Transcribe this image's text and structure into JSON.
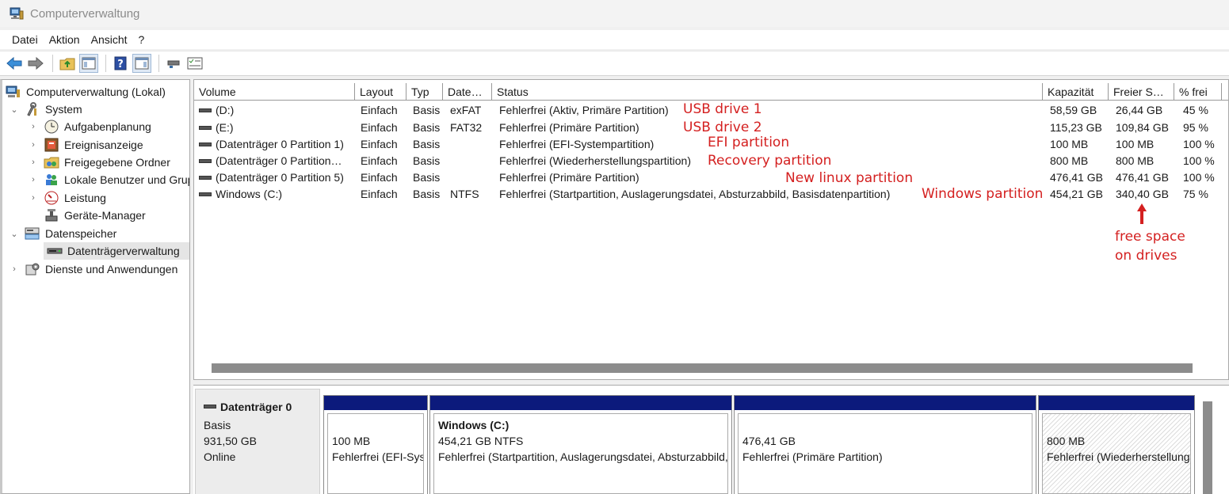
{
  "window": {
    "title": "Computerverwaltung"
  },
  "menu": [
    "Datei",
    "Aktion",
    "Ansicht",
    "?"
  ],
  "toolbar": {
    "icons": [
      "back-arrow-icon",
      "forward-arrow-icon",
      "folder-up-icon",
      "show-hide-tree-icon",
      "help-icon",
      "action-pane-icon",
      "connect-icon",
      "properties-icon"
    ]
  },
  "tree": [
    {
      "label": "Computerverwaltung (Lokal)",
      "icon": "computer-management-icon",
      "chevron": "",
      "level": 0
    },
    {
      "label": "System",
      "icon": "system-tools-icon",
      "chevron": "⌄",
      "level": 1
    },
    {
      "label": "Aufgabenplanung",
      "icon": "clock-icon",
      "chevron": "›",
      "level": 2
    },
    {
      "label": "Ereignisanzeige",
      "icon": "event-viewer-icon",
      "chevron": "›",
      "level": 2
    },
    {
      "label": "Freigegebene Ordner",
      "icon": "shared-folder-icon",
      "chevron": "›",
      "level": 2
    },
    {
      "label": "Lokale Benutzer und Gruppen",
      "icon": "users-icon",
      "chevron": "›",
      "level": 2
    },
    {
      "label": "Leistung",
      "icon": "performance-icon",
      "chevron": "›",
      "level": 2
    },
    {
      "label": "Geräte-Manager",
      "icon": "device-manager-icon",
      "chevron": "",
      "level": 2
    },
    {
      "label": "Datenspeicher",
      "icon": "storage-icon",
      "chevron": "⌄",
      "level": 1
    },
    {
      "label": "Datenträgerverwaltung",
      "icon": "disk-management-icon",
      "chevron": "",
      "level": 2,
      "selected": true
    },
    {
      "label": "Dienste und Anwendungen",
      "icon": "services-icon",
      "chevron": "›",
      "level": 1
    }
  ],
  "columns": [
    "Volume",
    "Layout",
    "Typ",
    "Date…",
    "Status",
    "Kapazität",
    "Freier S…",
    "% frei"
  ],
  "volumes": [
    {
      "volume": "(D:)",
      "layout": "Einfach",
      "typ": "Basis",
      "fs": "exFAT",
      "status": "Fehlerfrei (Aktiv, Primäre Partition)",
      "cap": "58,59 GB",
      "free": "26,44 GB",
      "pct": "45 %"
    },
    {
      "volume": "(E:)",
      "layout": "Einfach",
      "typ": "Basis",
      "fs": "FAT32",
      "status": "Fehlerfrei (Primäre Partition)",
      "cap": "115,23 GB",
      "free": "109,84 GB",
      "pct": "95 %"
    },
    {
      "volume": "(Datenträger 0 Partition 1)",
      "layout": "Einfach",
      "typ": "Basis",
      "fs": "",
      "status": "Fehlerfrei (EFI-Systempartition)",
      "cap": "100 MB",
      "free": "100 MB",
      "pct": "100 %"
    },
    {
      "volume": "(Datenträger 0 Partition…",
      "layout": "Einfach",
      "typ": "Basis",
      "fs": "",
      "status": "Fehlerfrei (Wiederherstellungspartition)",
      "cap": "800 MB",
      "free": "800 MB",
      "pct": "100 %"
    },
    {
      "volume": "(Datenträger 0 Partition 5)",
      "layout": "Einfach",
      "typ": "Basis",
      "fs": "",
      "status": "Fehlerfrei (Primäre Partition)",
      "cap": "476,41 GB",
      "free": "476,41 GB",
      "pct": "100 %"
    },
    {
      "volume": "Windows (C:)",
      "layout": "Einfach",
      "typ": "Basis",
      "fs": "NTFS",
      "status": "Fehlerfrei (Startpartition, Auslagerungsdatei, Absturzabbild, Basisdatenpartition)",
      "cap": "454,21 GB",
      "free": "340,40 GB",
      "pct": "75 %"
    }
  ],
  "annotations": {
    "usb1": "USB drive 1",
    "usb2": "USB drive 2",
    "efi": "EFI partition",
    "recovery": "Recovery partition",
    "linux": "New  linux partition",
    "windows": "Windows partition",
    "free_line1": "free space",
    "free_line2": "on drives",
    "color": "#d42020"
  },
  "disk": {
    "name": "Datenträger 0",
    "type": "Basis",
    "size": "931,50 GB",
    "state": "Online",
    "partitions": [
      {
        "title": "",
        "size": "100 MB",
        "status": "Fehlerfrei (EFI-Systempartition)"
      },
      {
        "title": "Windows  (C:)",
        "size": "454,21 GB NTFS",
        "status": "Fehlerfrei (Startpartition, Auslagerungsdatei, Absturzabbild, Basisdatenpartition)"
      },
      {
        "title": "",
        "size": "476,41 GB",
        "status": "Fehlerfrei (Primäre Partition)"
      },
      {
        "title": "",
        "size": "800 MB",
        "status": "Fehlerfrei (Wiederherstellungspartition)"
      }
    ],
    "bar_color": "#0c1a7c"
  }
}
